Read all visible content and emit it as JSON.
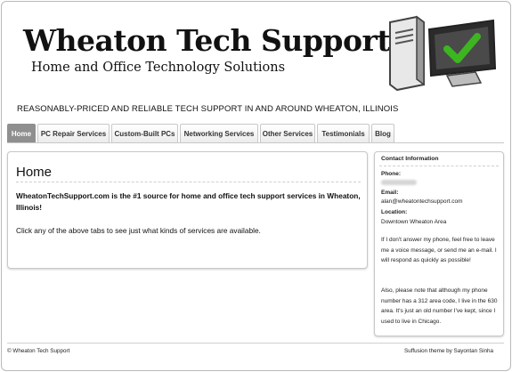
{
  "header": {
    "title": "Wheaton Tech Support",
    "tagline": "Home and Office Technology Solutions",
    "slogan": "REASONABLY-PRICED AND RELIABLE TECH SUPPORT IN AND AROUND WHEATON, ILLINOIS"
  },
  "nav": {
    "tabs": [
      {
        "label": "Home",
        "active": true
      },
      {
        "label": "PC Repair Services",
        "active": false
      },
      {
        "label": "Custom-Built PCs",
        "active": false
      },
      {
        "label": "Networking Services",
        "active": false
      },
      {
        "label": "Other Services",
        "active": false
      },
      {
        "label": "Testimonials",
        "active": false
      },
      {
        "label": "Blog",
        "active": false
      }
    ]
  },
  "main": {
    "title": "Home",
    "lead": "WheatonTechSupport.com is the #1 source for home and office tech support services in Wheaton, Illinois!",
    "text": "Click any of the above tabs to see just what kinds of services are available."
  },
  "sidebar": {
    "title": "Contact Information",
    "phone_label": "Phone:",
    "email_label": "Email:",
    "email_value": "alan@wheatontechsupport.com",
    "location_label": "Location:",
    "location_value": "Downtown Wheaton Area",
    "para1": "If I don't answer my phone, feel free to leave me a voice message, or send me an e-mail. I will respond as quickly as possible!",
    "para2": "Also, please note that although my phone number has a 312 area code, I live in the 630 area. It's just an old number I've kept, since I used to live in Chicago."
  },
  "footer": {
    "copyright": "© Wheaton Tech Support",
    "credit": "Suffusion theme by Sayontan Sinha"
  },
  "colors": {
    "active_tab": "#8f8f8f",
    "check_green": "#3cb521",
    "border": "#c8c8c8"
  },
  "icons": {
    "logo": "computer-checkmark-icon"
  }
}
